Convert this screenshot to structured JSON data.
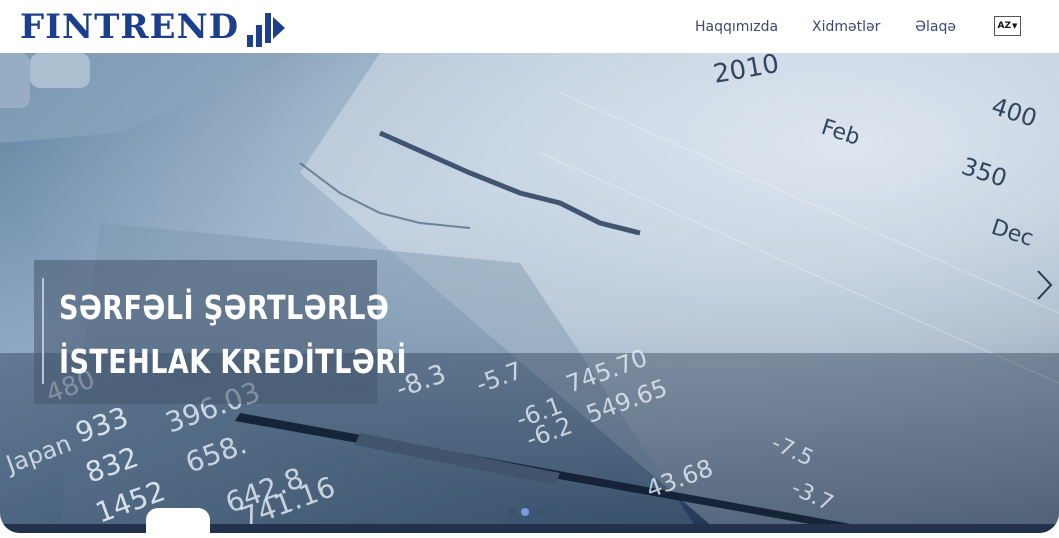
{
  "brand": {
    "name": "FINTREND",
    "logo_icon": "bar-chart-arrow-icon",
    "color": "#1c3f8c"
  },
  "nav": {
    "items": [
      {
        "label": "Haqqımızda"
      },
      {
        "label": "Xidmətlər"
      },
      {
        "label": "Əlaqə"
      }
    ],
    "language": {
      "label": "AZ",
      "icon": "caret-down-icon"
    }
  },
  "hero": {
    "caption_lines": [
      "SƏRFƏLİ ŞƏRTLƏRLƏ",
      "İSTEHLAK KREDİTLƏRİ"
    ],
    "background_text": [
      "2010",
      "Feb",
      "350",
      "400",
      "Dec",
      "933",
      "832",
      "1452",
      "480",
      "396.03",
      "658.",
      "642.8",
      "741.16",
      "-8.3",
      "-5.7",
      "-6.1",
      "-6.2",
      "745.70",
      "549.65",
      "43.68",
      "-7.5",
      "-3.7",
      "Japan"
    ],
    "carousel": {
      "slides": 3,
      "active_index": 1
    },
    "next_icon": "chevron-right-icon"
  }
}
